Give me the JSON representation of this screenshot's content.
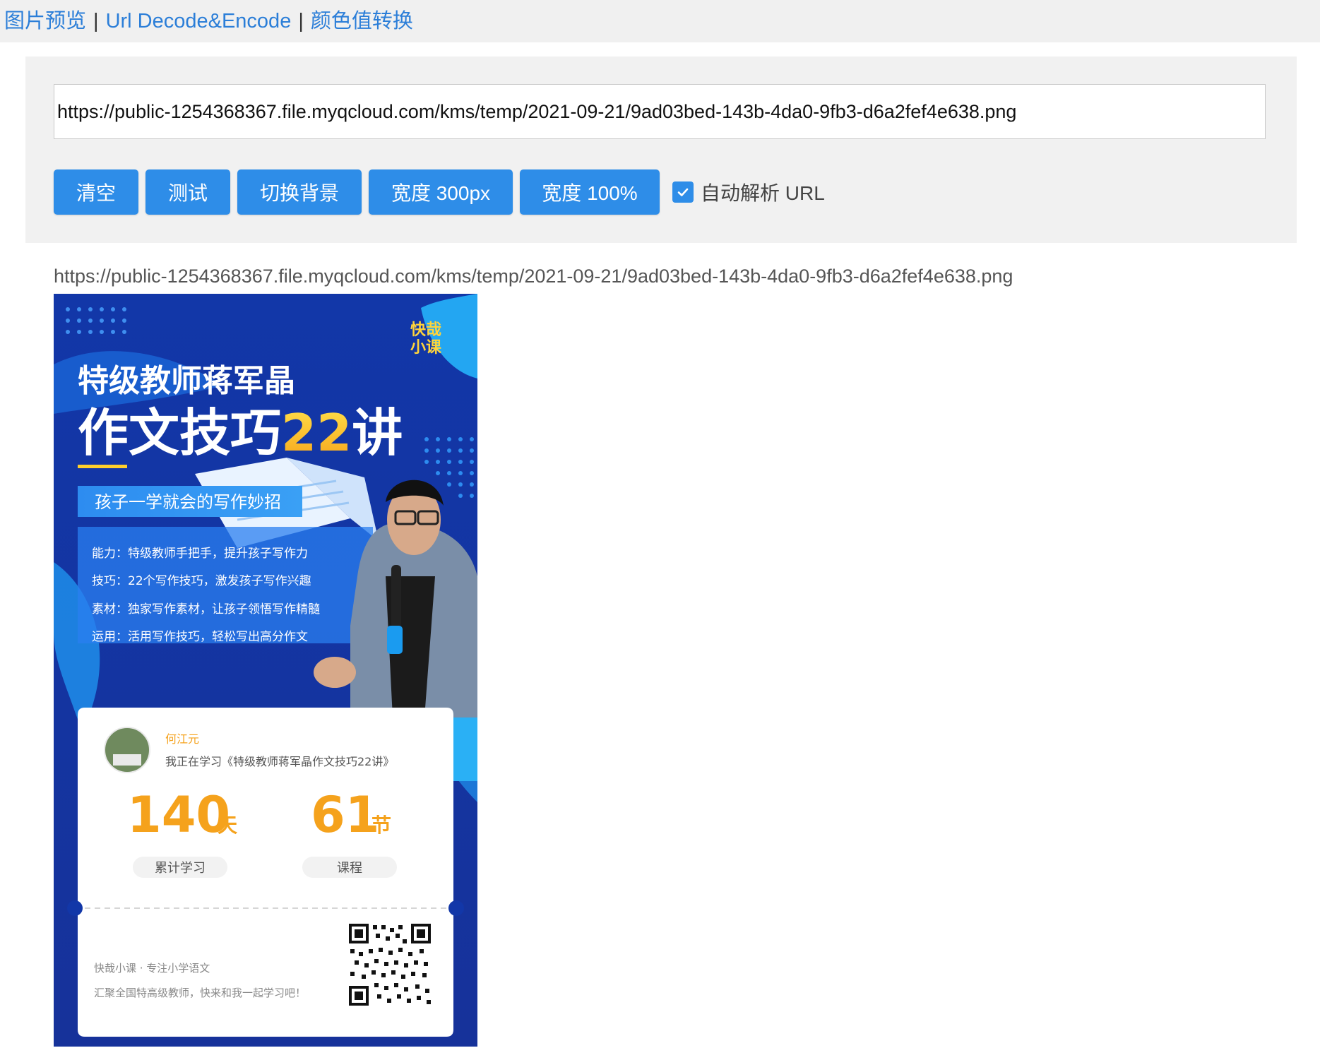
{
  "nav": {
    "link1": "图片预览",
    "sep1": "|",
    "link2": "Url Decode&Encode",
    "sep2": "|",
    "link3": "颜色值转换"
  },
  "input": {
    "value": "https://public-1254368367.file.myqcloud.com/kms/temp/2021-09-21/9ad03bed-143b-4da0-9fb3-d6a2fef4e638.png"
  },
  "buttons": {
    "clear": "清空",
    "test": "测试",
    "toggle_bg": "切换背景",
    "width_300": "宽度 300px",
    "width_100": "宽度 100%"
  },
  "auto_parse": {
    "label": "自动解析 URL",
    "checked": true
  },
  "preview_url": "https://public-1254368367.file.myqcloud.com/kms/temp/2021-09-21/9ad03bed-143b-4da0-9fb3-d6a2fef4e638.png",
  "poster": {
    "brand": "快哉小课",
    "brand_line1": "快哉",
    "brand_line2": "小课",
    "title_line1": "特级教师蒋军晶",
    "title_line2a": "作文技巧",
    "title_line2b": "22",
    "title_line2c": "讲",
    "tagline": "孩子一学就会的写作妙招",
    "features": [
      "能力：特级教师手把手，提升孩子写作力",
      "技巧：22个写作技巧，激发孩子写作兴趣",
      "素材：独家写作素材，让孩子领悟写作精髓",
      "运用：活用写作技巧，轻松写出高分作文"
    ],
    "user_name": "何江元",
    "user_status": "我正在学习《特级教师蒋军晶作文技巧22讲》",
    "stat1_value": "140",
    "stat1_unit": "天",
    "stat1_label": "累计学习",
    "stat2_value": "61",
    "stat2_unit": "节",
    "stat2_label": "课程",
    "footer_line1": "快哉小课 · 专注小学语文",
    "footer_line2": "汇聚全国特高级教师，快来和我一起学习吧！"
  },
  "colors": {
    "link": "#2b7ed8",
    "button": "#2e8de8",
    "poster_blue": "#1a3aa6",
    "accent_orange": "#f5a21c"
  }
}
